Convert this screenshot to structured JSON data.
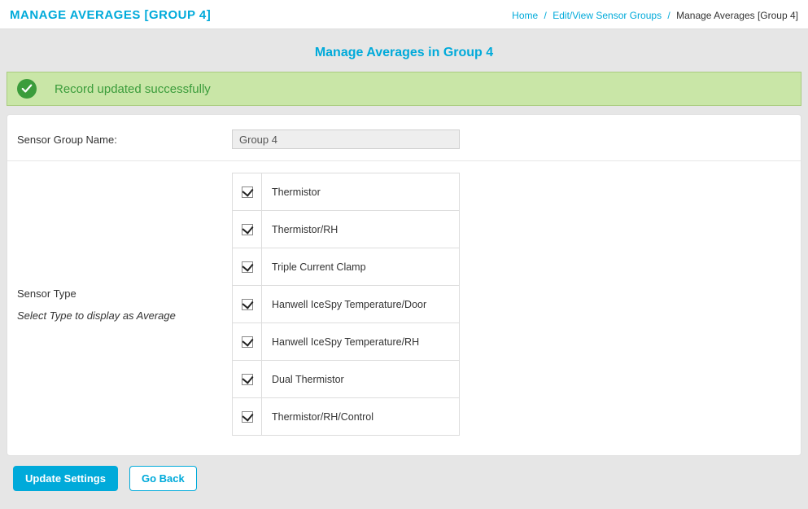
{
  "header": {
    "title": "MANAGE AVERAGES [GROUP 4]"
  },
  "breadcrumb": {
    "home": "Home",
    "sensor_groups": "Edit/View Sensor Groups",
    "current": "Manage Averages [Group 4]"
  },
  "subtitle": "Manage Averages in Group 4",
  "alert": {
    "message": "Record updated successfully"
  },
  "form": {
    "group_name_label": "Sensor Group Name:",
    "group_name_value": "Group 4",
    "sensor_type_label": "Sensor Type",
    "sensor_type_hint": "Select Type to display as Average"
  },
  "sensor_types": [
    {
      "label": "Thermistor",
      "checked": true
    },
    {
      "label": "Thermistor/RH",
      "checked": true
    },
    {
      "label": "Triple Current Clamp",
      "checked": true
    },
    {
      "label": "Hanwell IceSpy Temperature/Door",
      "checked": true
    },
    {
      "label": "Hanwell IceSpy Temperature/RH",
      "checked": true
    },
    {
      "label": "Dual Thermistor",
      "checked": true
    },
    {
      "label": "Thermistor/RH/Control",
      "checked": true
    }
  ],
  "actions": {
    "update": "Update Settings",
    "back": "Go Back"
  }
}
